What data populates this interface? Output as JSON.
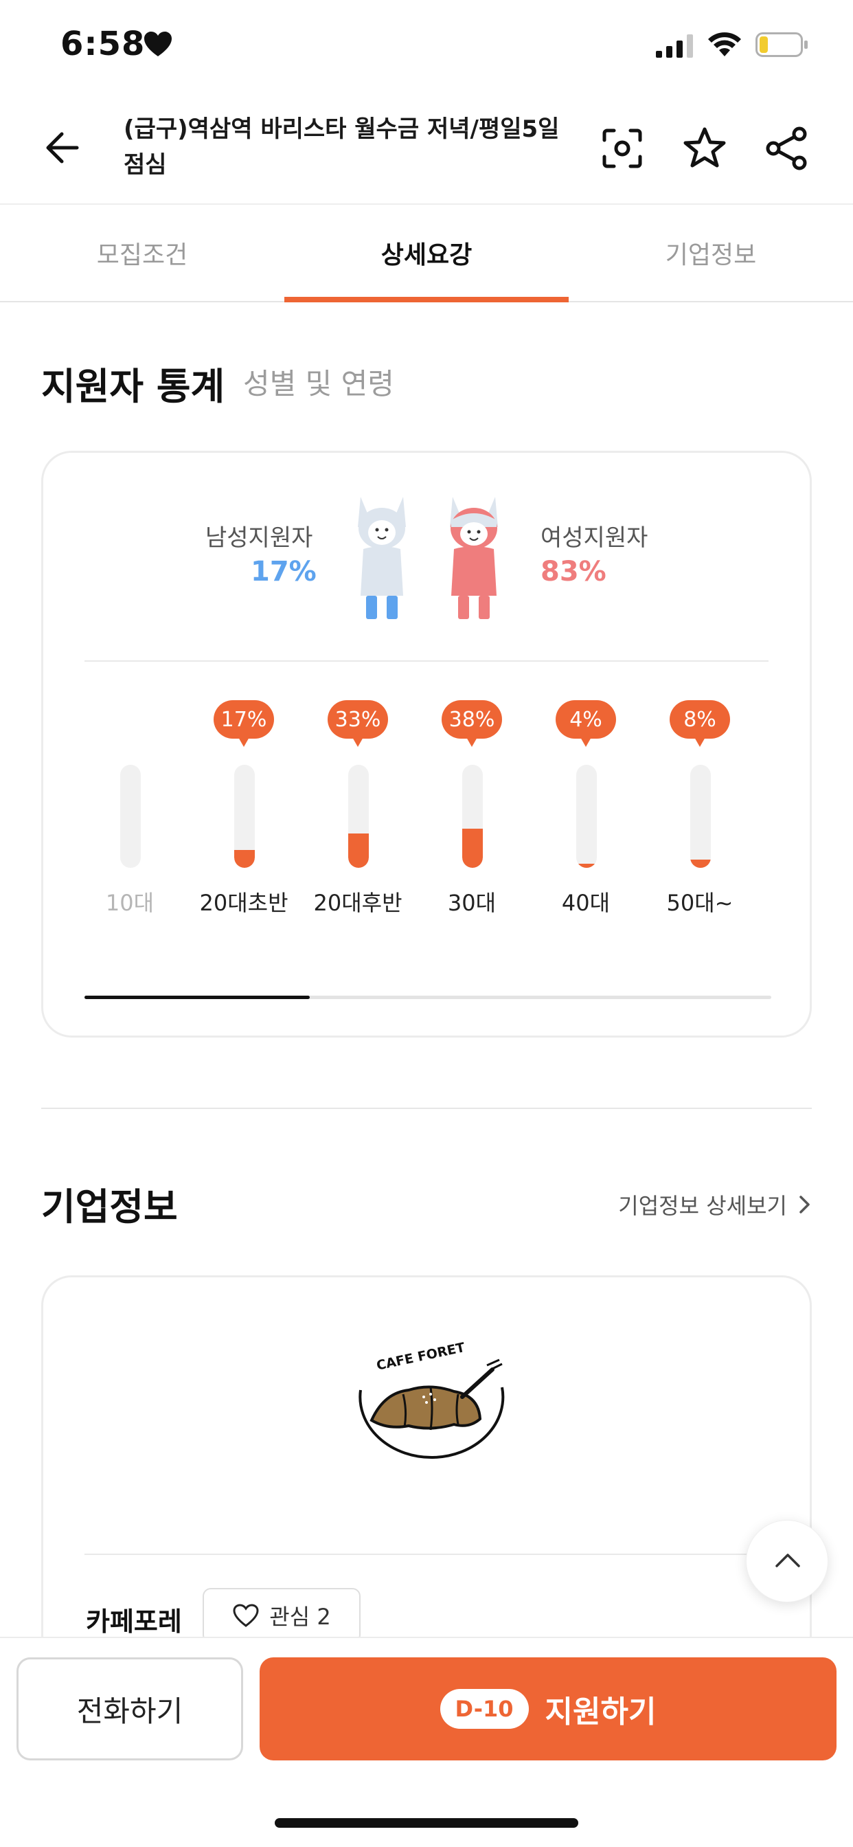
{
  "status": {
    "time": "6:58"
  },
  "header": {
    "title": "(급구)역삼역 바리스타 월수금 저녁/평일5일 점심"
  },
  "tabs": [
    {
      "label": "모집조건",
      "active": false
    },
    {
      "label": "상세요강",
      "active": true
    },
    {
      "label": "기업정보",
      "active": false
    }
  ],
  "stats": {
    "title": "지원자 통계",
    "subtitle": "성별 및 연령",
    "male": {
      "label": "남성지원자",
      "percent": "17%",
      "color": "#5ea3ee"
    },
    "female": {
      "label": "여성지원자",
      "percent": "83%",
      "color": "#ef7d7d"
    },
    "ages": [
      {
        "label": "10대",
        "percent": "",
        "value": 0
      },
      {
        "label": "20대초반",
        "percent": "17%",
        "value": 17
      },
      {
        "label": "20대후반",
        "percent": "33%",
        "value": 33
      },
      {
        "label": "30대",
        "percent": "38%",
        "value": 38
      },
      {
        "label": "40대",
        "percent": "4%",
        "value": 4
      },
      {
        "label": "50대~",
        "percent": "8%",
        "value": 8
      }
    ]
  },
  "company": {
    "title": "기업정보",
    "detail_link": "기업정보 상세보기",
    "logo_text": "CAFE FORET",
    "name": "카페포레",
    "interest_label": "관심 2"
  },
  "bottom": {
    "call_label": "전화하기",
    "dday": "D-10",
    "apply_label": "지원하기"
  },
  "colors": {
    "accent": "#ee6534"
  }
}
